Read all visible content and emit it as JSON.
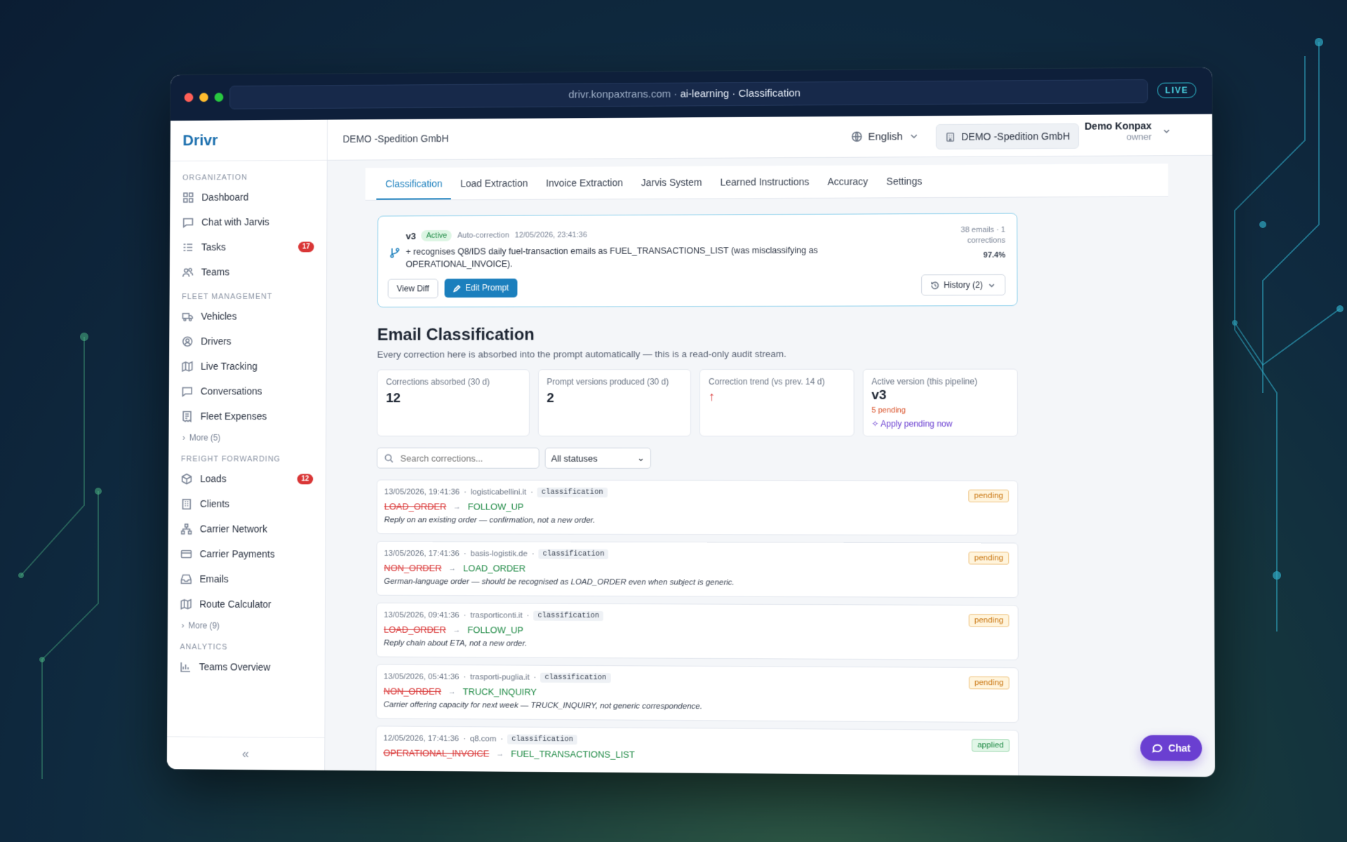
{
  "browser": {
    "url_host": "drivr.konpaxtrans.com",
    "url_sep": " · ",
    "url_path": "ai-learning · Classification",
    "live_label": "LIVE"
  },
  "sidebar": {
    "brand": "Drivr",
    "sections": [
      {
        "title": "ORGANIZATION",
        "items": [
          {
            "label": "Dashboard",
            "icon": "dashboard-icon",
            "badge": ""
          },
          {
            "label": "Chat with Jarvis",
            "icon": "chat-icon",
            "badge": ""
          },
          {
            "label": "Tasks",
            "icon": "tasks-icon",
            "badge": "17"
          },
          {
            "label": "Teams",
            "icon": "teams-icon",
            "badge": ""
          }
        ],
        "more": ""
      },
      {
        "title": "FLEET MANAGEMENT",
        "items": [
          {
            "label": "Vehicles",
            "icon": "truck-icon",
            "badge": ""
          },
          {
            "label": "Drivers",
            "icon": "driver-icon",
            "badge": ""
          },
          {
            "label": "Live Tracking",
            "icon": "map-icon",
            "badge": ""
          },
          {
            "label": "Conversations",
            "icon": "chat-icon",
            "badge": ""
          },
          {
            "label": "Fleet Expenses",
            "icon": "receipt-icon",
            "badge": ""
          }
        ],
        "more": "More (5)"
      },
      {
        "title": "FREIGHT FORWARDING",
        "items": [
          {
            "label": "Loads",
            "icon": "box-icon",
            "badge": "12"
          },
          {
            "label": "Clients",
            "icon": "building-icon",
            "badge": ""
          },
          {
            "label": "Carrier Network",
            "icon": "network-icon",
            "badge": ""
          },
          {
            "label": "Carrier Payments",
            "icon": "card-icon",
            "badge": ""
          },
          {
            "label": "Emails",
            "icon": "inbox-icon",
            "badge": ""
          },
          {
            "label": "Route Calculator",
            "icon": "map-icon",
            "badge": ""
          }
        ],
        "more": "More (9)"
      },
      {
        "title": "ANALYTICS",
        "items": [
          {
            "label": "Teams Overview",
            "icon": "bar-chart-icon",
            "badge": ""
          }
        ],
        "more": ""
      }
    ],
    "collapse": "«"
  },
  "header": {
    "org_name": "DEMO -Spedition GmbH",
    "language": "English",
    "org_button": "DEMO -Spedition GmbH",
    "user_name": "Demo Konpax",
    "user_role": "owner"
  },
  "tabs": [
    "Classification",
    "Load Extraction",
    "Invoice Extraction",
    "Jarvis System",
    "Learned Instructions",
    "Accuracy",
    "Settings"
  ],
  "prompt_card": {
    "version": "v3",
    "status": "Active",
    "source": "Auto-correction",
    "timestamp": "12/05/2026, 23:41:36",
    "description": "+ recognises Q8/IDS daily fuel-transaction emails as FUEL_TRANSACTIONS_LIST (was misclassifying as OPERATIONAL_INVOICE).",
    "stats_line": "38 emails · 1 corrections",
    "accuracy": "97.4%",
    "view_diff": "View Diff",
    "edit_prompt": "Edit Prompt",
    "history": "History (2)"
  },
  "page": {
    "title": "Email Classification",
    "subtitle": "Every correction here is absorbed into the prompt automatically — this is a read-only audit stream."
  },
  "stats": {
    "absorbed_label": "Corrections absorbed (30 d)",
    "absorbed_value": "12",
    "versions_label": "Prompt versions produced (30 d)",
    "versions_value": "2",
    "trend_label": "Correction trend (vs prev. 14 d)",
    "trend_symbol": "↑",
    "active_label": "Active version (this pipeline)",
    "active_value": "v3",
    "pending": "5 pending",
    "apply": "Apply pending now"
  },
  "filters": {
    "search_placeholder": "Search corrections...",
    "status_value": "All statuses"
  },
  "corrections": [
    {
      "time": "13/05/2026, 19:41:36",
      "domain": "logisticabellini.it",
      "type": "classification",
      "from": "LOAD_ORDER",
      "to": "FOLLOW_UP",
      "note": "Reply on an existing order — confirmation, not a new order.",
      "status": "pending"
    },
    {
      "time": "13/05/2026, 17:41:36",
      "domain": "basis-logistik.de",
      "type": "classification",
      "from": "NON_ORDER",
      "to": "LOAD_ORDER",
      "note": "German-language order — should be recognised as LOAD_ORDER even when subject is generic.",
      "status": "pending"
    },
    {
      "time": "13/05/2026, 09:41:36",
      "domain": "trasporticonti.it",
      "type": "classification",
      "from": "LOAD_ORDER",
      "to": "FOLLOW_UP",
      "note": "Reply chain about ETA, not a new order.",
      "status": "pending"
    },
    {
      "time": "13/05/2026, 05:41:36",
      "domain": "trasporti-puglia.it",
      "type": "classification",
      "from": "NON_ORDER",
      "to": "TRUCK_INQUIRY",
      "note": "Carrier offering capacity for next week — TRUCK_INQUIRY, not generic correspondence.",
      "status": "pending"
    },
    {
      "time": "12/05/2026, 17:41:36",
      "domain": "q8.com",
      "type": "classification",
      "from": "OPERATIONAL_INVOICE",
      "to": "FUEL_TRANSACTIONS_LIST",
      "note": "",
      "status": "applied"
    }
  ],
  "chat_button": "Chat"
}
